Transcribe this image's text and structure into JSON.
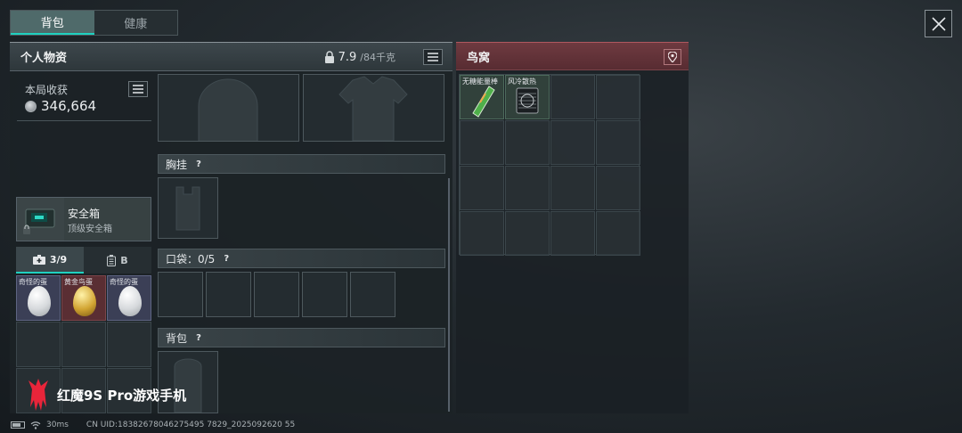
{
  "tabs": [
    {
      "label": "背包",
      "active": true
    },
    {
      "label": "健康",
      "active": false
    }
  ],
  "personal": {
    "title": "个人物资",
    "weight_current": "7.9",
    "weight_max": "/84千克"
  },
  "haul": {
    "title": "本局收获",
    "value": "346,664"
  },
  "safe": {
    "name": "安全箱",
    "sub": "顶级安全箱"
  },
  "subtabs": [
    {
      "label": "3/9",
      "icon": "medkit-icon",
      "active": true
    },
    {
      "label": "B",
      "icon": "device-icon",
      "active": false
    }
  ],
  "eggs": [
    {
      "label": "奇怪的蛋",
      "variant": "white"
    },
    {
      "label": "黄金鸟蛋",
      "variant": "gold"
    },
    {
      "label": "奇怪的蛋",
      "variant": "white"
    }
  ],
  "sections": {
    "chest": "胸挂",
    "pocket": "口袋：0/5",
    "backpack": "背包",
    "help": "?"
  },
  "nest": {
    "title": "鸟窝",
    "items": [
      {
        "label": "无糖能量棒"
      },
      {
        "label": "风冷散热"
      }
    ]
  },
  "watermark": "红魔9S Pro游戏手机",
  "status": {
    "ping": "30ms",
    "uid": "CN UID:18382678046275495 7829_2025092620 55"
  },
  "colors": {
    "accent": "#1fd1c0",
    "nest_header": "#6e3a40",
    "gold_item_bg": "#5a2e33",
    "item_bg": "#3b3f56"
  }
}
